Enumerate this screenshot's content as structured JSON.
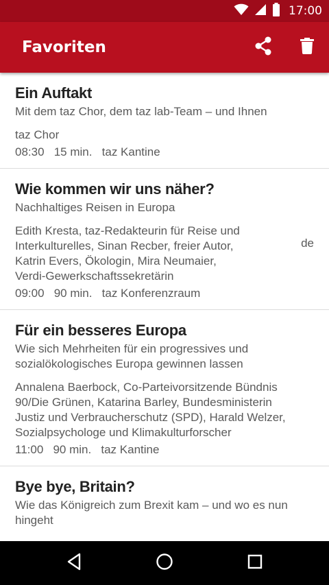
{
  "status_bar": {
    "time": "17:00",
    "icons": [
      "wifi-icon",
      "cell-signal-icon",
      "battery-icon"
    ]
  },
  "app_bar": {
    "title": "Favoriten",
    "actions": [
      "share-icon",
      "delete-icon"
    ]
  },
  "colors": {
    "status_bar": "#9e0b1a",
    "app_bar": "#b8101f",
    "title_text": "#222222",
    "body_text": "#5a5a5a",
    "divider": "#dcdcdc"
  },
  "events": [
    {
      "title": "Ein Auftakt",
      "subtitle": "Mit dem taz Chor, dem taz lab-Team – und Ihnen",
      "people": "taz Chor",
      "time": "08:30",
      "duration": "15 min.",
      "location": "taz Kantine",
      "side_tag": ""
    },
    {
      "title": "Wie kommen wir uns näher?",
      "subtitle": "Nachhaltiges Reisen in Europa",
      "people": "Edith Kresta, taz-Redakteurin für Reise und Interkulturelles, Sinan Recber, freier Autor, Katrin Evers, Ökologin, Mira Neumaier, Verdi-Gewerkschaftssekretärin",
      "time": "09:00",
      "duration": "90 min.",
      "location": "taz Konferenzraum",
      "side_tag": "de"
    },
    {
      "title": "Für ein besseres Europa",
      "subtitle": "Wie sich Mehrheiten für ein progressives und sozialökologisches Europa gewinnen lassen",
      "people": "Annalena Baerbock, Co-Parteivorsitzende Bündnis 90/Die Grünen, Katarina Barley, Bundesministerin Justiz und Verbraucherschutz (SPD), Harald Welzer, Sozialpsychologe und Klimakulturforscher",
      "time": "11:00",
      "duration": "90 min.",
      "location": "taz Kantine",
      "side_tag": ""
    },
    {
      "title": "Bye bye, Britain?",
      "subtitle": "Wie das Königreich zum Brexit kam – und wo es nun hingeht",
      "people": "",
      "time": "",
      "duration": "",
      "location": "",
      "side_tag": ""
    }
  ],
  "nav_bar": {
    "buttons": [
      "back-icon",
      "home-icon",
      "recents-icon"
    ]
  }
}
